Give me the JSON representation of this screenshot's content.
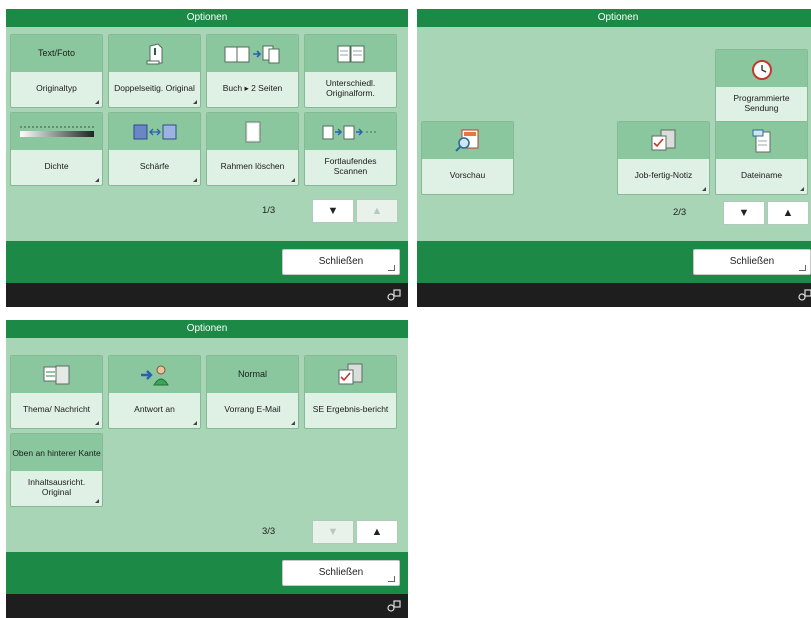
{
  "title": "Optionen",
  "close_label": "Schließen",
  "panel1": {
    "buttons": {
      "originaltyp": {
        "value": "Text/Foto",
        "label": "Originaltyp"
      },
      "doppelseitig": {
        "label": "Doppelseitig. Original"
      },
      "buch": {
        "label": "Buch ▸ 2 Seiten"
      },
      "unterschiedl": {
        "label": "Unterschiedl. Originalform."
      },
      "dichte": {
        "label": "Dichte"
      },
      "schaerfe": {
        "label": "Schärfe"
      },
      "rahmen": {
        "label": "Rahmen löschen"
      },
      "fortlaufend": {
        "label": "Fortlaufendes Scannen"
      }
    },
    "page": "1/3"
  },
  "panel2": {
    "buttons": {
      "programmierte": {
        "label": "Programmierte Sendung"
      },
      "vorschau": {
        "label": "Vorschau"
      },
      "jobfertig": {
        "label": "Job-fertig-Notiz"
      },
      "dateiname": {
        "label": "Dateiname"
      }
    },
    "page": "2/3"
  },
  "panel3": {
    "buttons": {
      "thema": {
        "label": "Thema/ Nachricht"
      },
      "antwort": {
        "label": "Antwort an"
      },
      "vorrang": {
        "value": "Normal",
        "label": "Vorrang E-Mail"
      },
      "seergebnis": {
        "label": "SE Ergebnis-bericht"
      },
      "inhalt": {
        "value": "Oben an hinterer Kante",
        "label": "Inhaltsausricht. Original"
      }
    },
    "page": "3/3"
  },
  "nav": {
    "down": "▼",
    "up": "▲"
  },
  "colors": {
    "titlebar": "#1c8a46",
    "body": "#a8d5b5",
    "button_top": "#8bc79e",
    "button_bottom": "#dff0e4",
    "statusbar": "#1e1e1e"
  }
}
